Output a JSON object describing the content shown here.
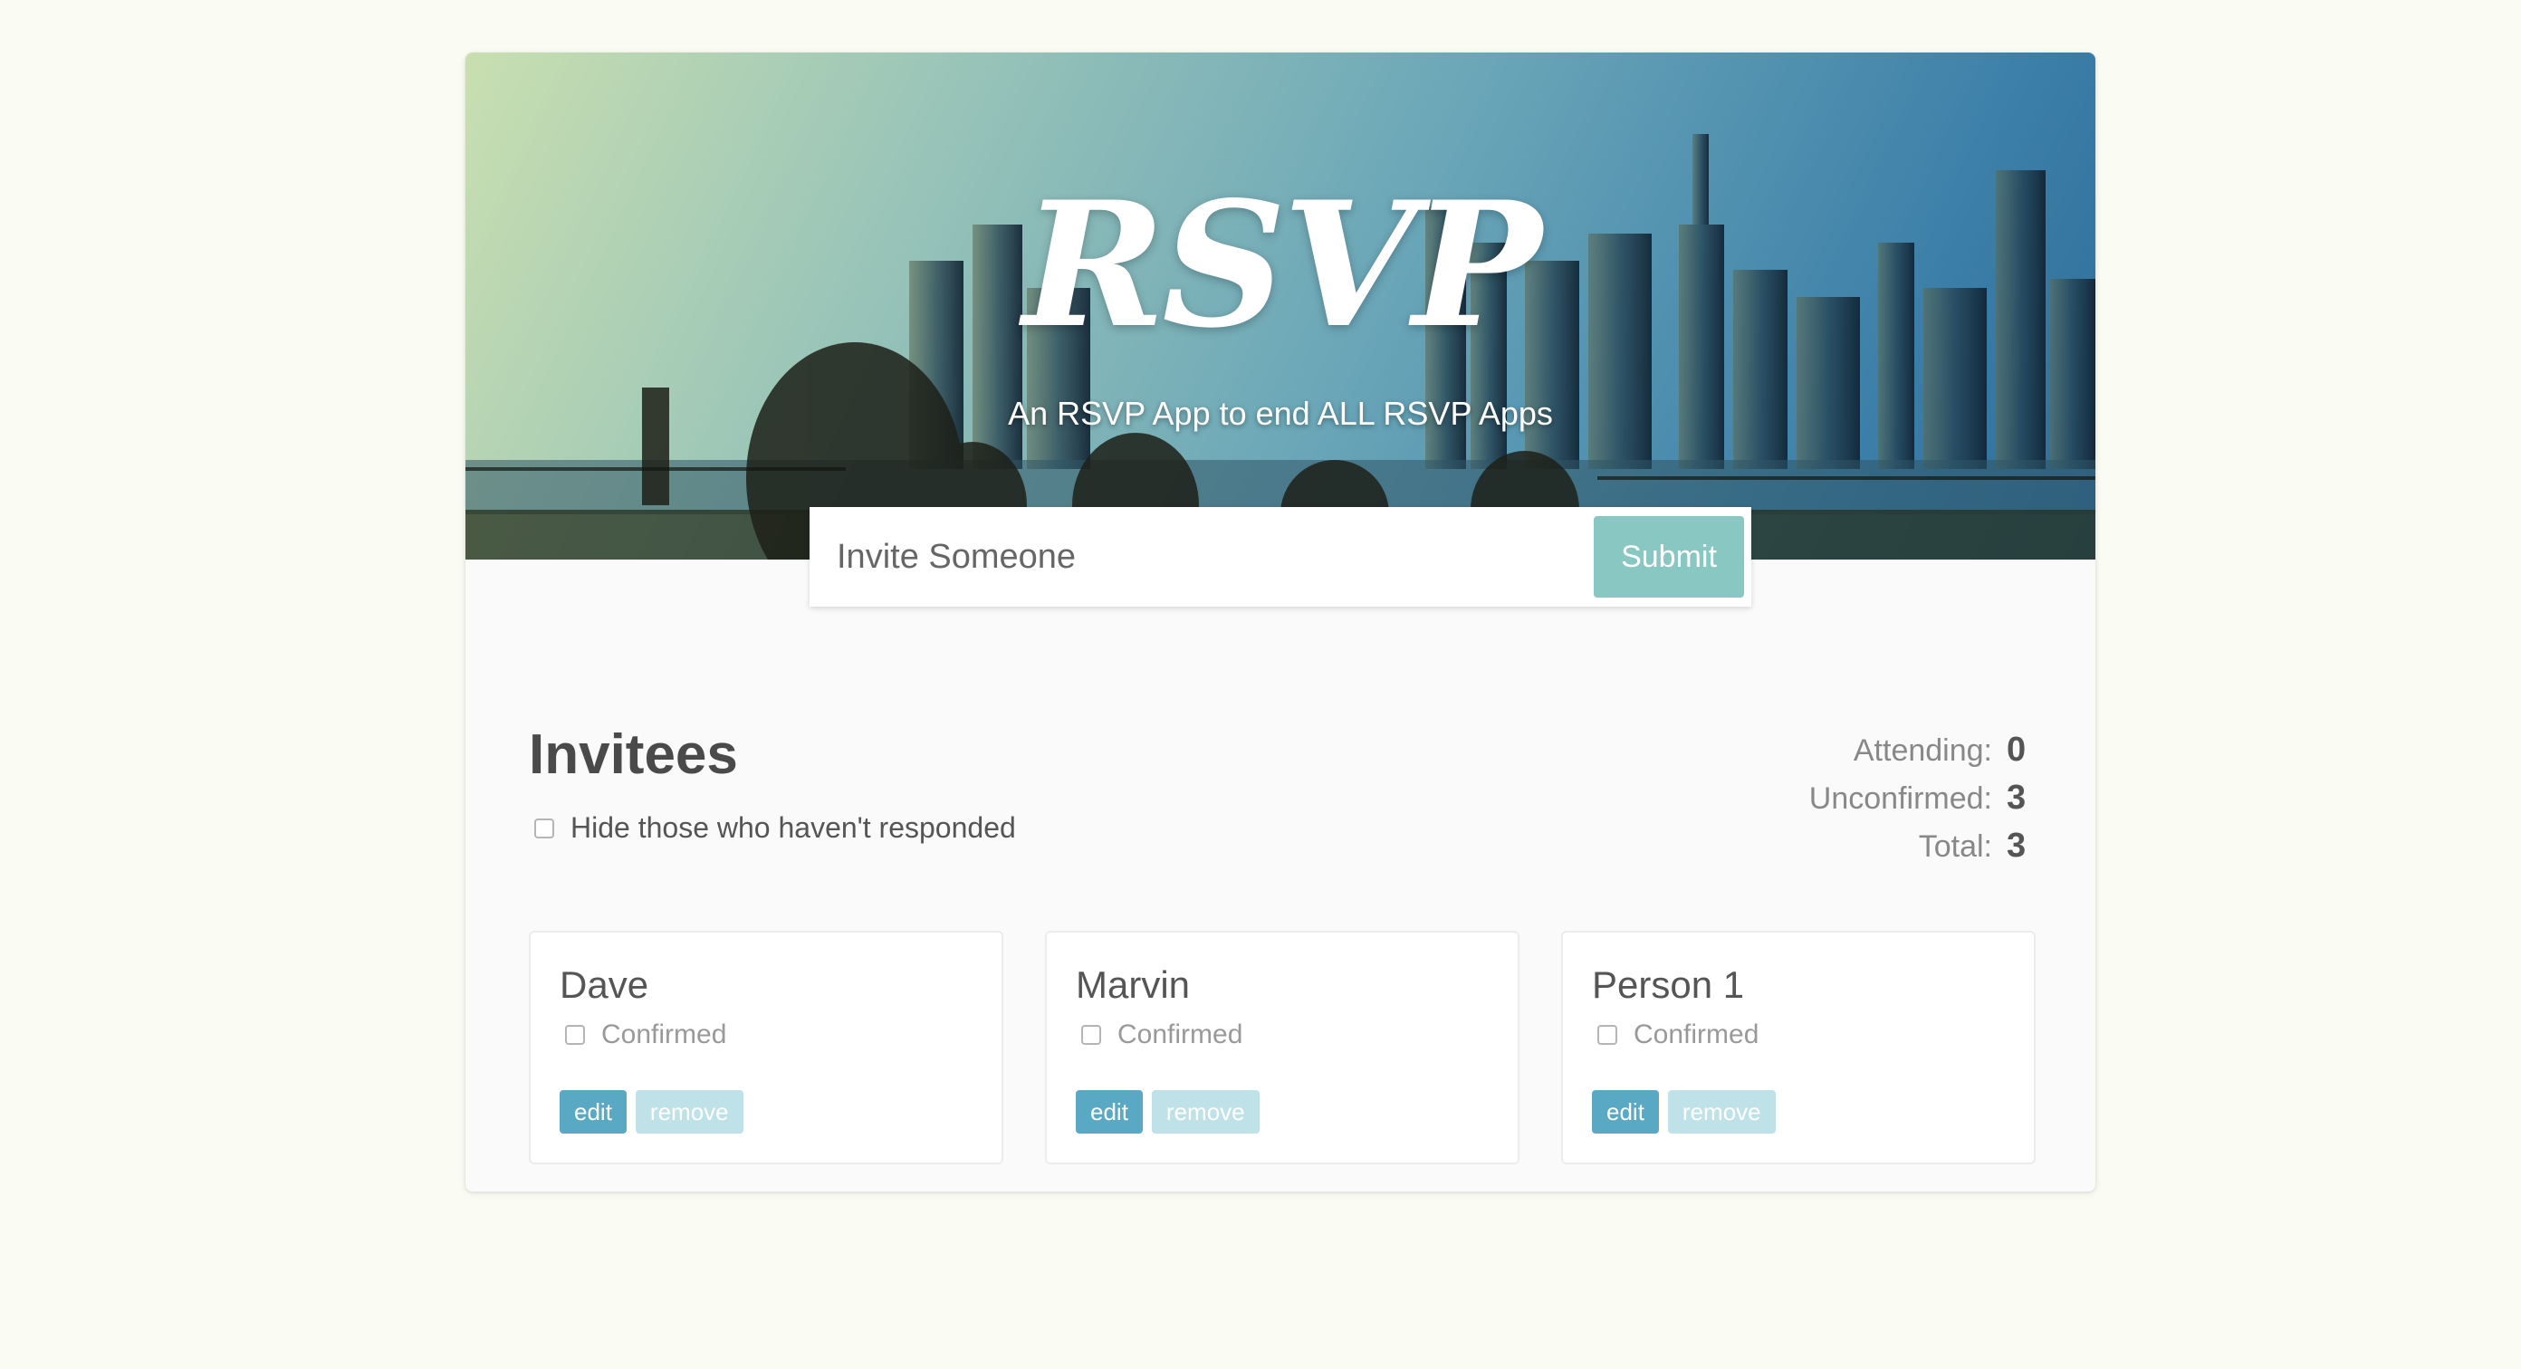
{
  "header": {
    "logo": "RSVP",
    "subtitle": "An RSVP App to end ALL RSVP Apps"
  },
  "invite_form": {
    "placeholder": "Invite Someone",
    "submit_label": "Submit"
  },
  "main": {
    "title": "Invitees",
    "hide_label": "Hide those who haven't responded",
    "hide_checked": false
  },
  "counter": {
    "attending_label": "Attending:",
    "attending_value": "0",
    "unconfirmed_label": "Unconfirmed:",
    "unconfirmed_value": "3",
    "total_label": "Total:",
    "total_value": "3"
  },
  "guests": [
    {
      "name": "Dave",
      "confirmed_label": "Confirmed",
      "confirmed": false,
      "edit_label": "edit",
      "remove_label": "remove"
    },
    {
      "name": "Marvin",
      "confirmed_label": "Confirmed",
      "confirmed": false,
      "edit_label": "edit",
      "remove_label": "remove"
    },
    {
      "name": "Person 1",
      "confirmed_label": "Confirmed",
      "confirmed": false,
      "edit_label": "edit",
      "remove_label": "remove"
    }
  ],
  "colors": {
    "page_background": "#fafcf4",
    "submit_button": "#88c7c2",
    "edit_button": "#5aa9c4",
    "remove_button": "#bfe2e9"
  }
}
